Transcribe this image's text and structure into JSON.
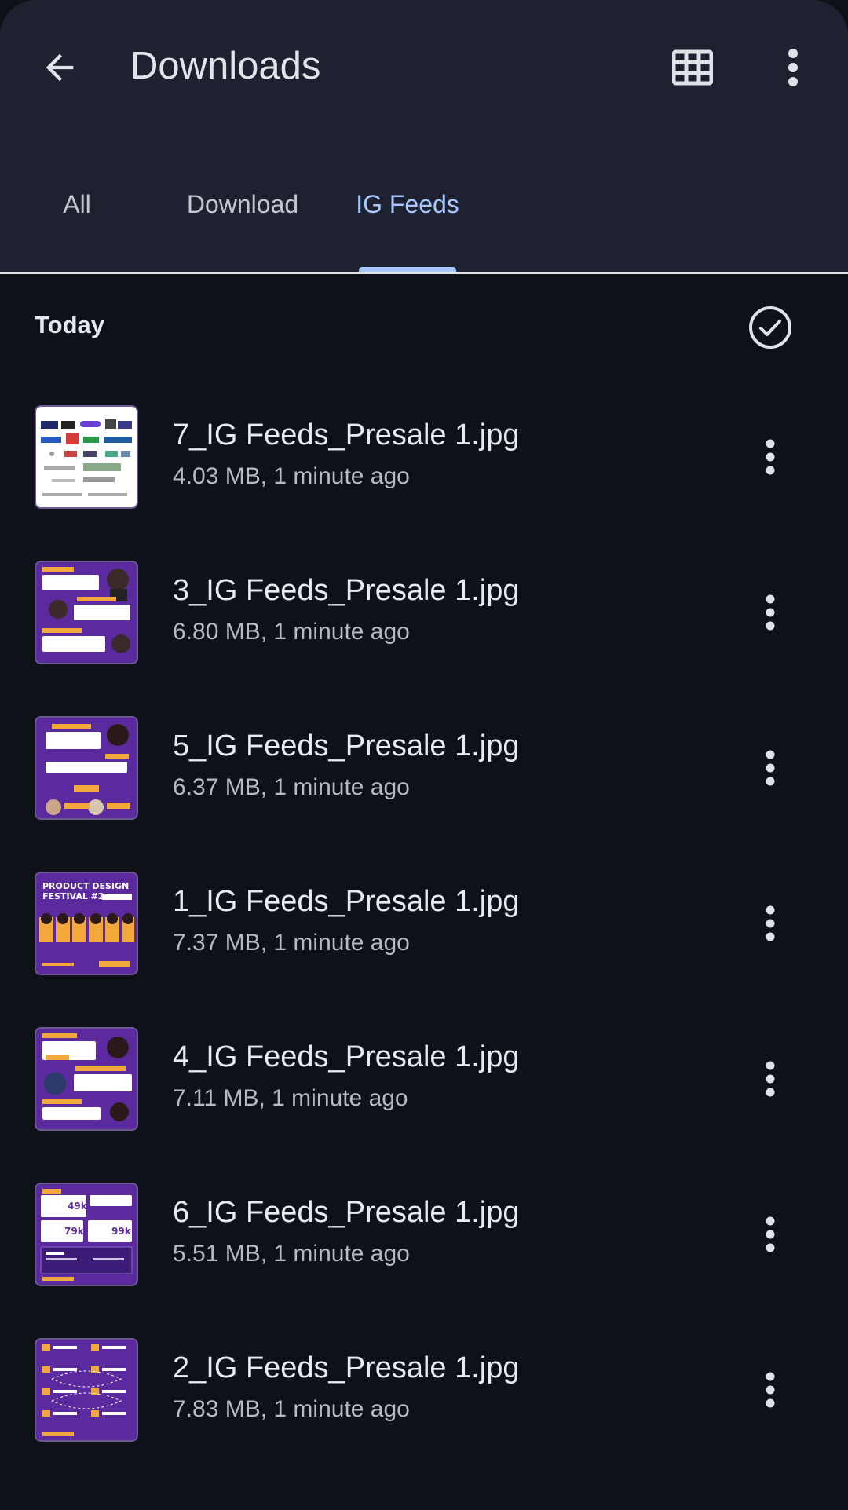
{
  "header": {
    "title": "Downloads",
    "back_icon": "arrow-back-icon",
    "view_icon": "grid-view-icon",
    "more_icon": "more-vert-icon"
  },
  "tabs": [
    {
      "label": "All",
      "active": false
    },
    {
      "label": "Download",
      "active": false
    },
    {
      "label": "IG Feeds",
      "active": true
    }
  ],
  "colors": {
    "accent": "#a6c8ff",
    "header_bg": "#1e2230",
    "list_bg": "#0e1118",
    "thumb_purple": "#5b2a9e"
  },
  "section": {
    "label": "Today",
    "select_icon": "check-circle-icon"
  },
  "files": [
    {
      "name": "7_IG Feeds_Presale 1.jpg",
      "meta": "4.03 MB, 1 minute ago",
      "thumb": "white-logos"
    },
    {
      "name": "3_IG Feeds_Presale 1.jpg",
      "meta": "6.80 MB, 1 minute ago",
      "thumb": "purple-speakers"
    },
    {
      "name": "5_IG Feeds_Presale 1.jpg",
      "meta": "6.37 MB, 1 minute ago",
      "thumb": "purple-speakers"
    },
    {
      "name": "1_IG Feeds_Presale 1.jpg",
      "meta": "7.37 MB, 1 minute ago",
      "thumb": "purple-poster"
    },
    {
      "name": "4_IG Feeds_Presale 1.jpg",
      "meta": "7.11 MB, 1 minute ago",
      "thumb": "purple-speakers"
    },
    {
      "name": "6_IG Feeds_Presale 1.jpg",
      "meta": "5.51 MB, 1 minute ago",
      "thumb": "purple-stats"
    },
    {
      "name": "2_IG Feeds_Presale 1.jpg",
      "meta": "7.83 MB, 1 minute ago",
      "thumb": "purple-timeline"
    }
  ],
  "thumbnail_text": {
    "poster_title": "PRODUCT DESIGN FESTIVAL #2",
    "stat_values": [
      "49k",
      "79k",
      "99k"
    ]
  }
}
